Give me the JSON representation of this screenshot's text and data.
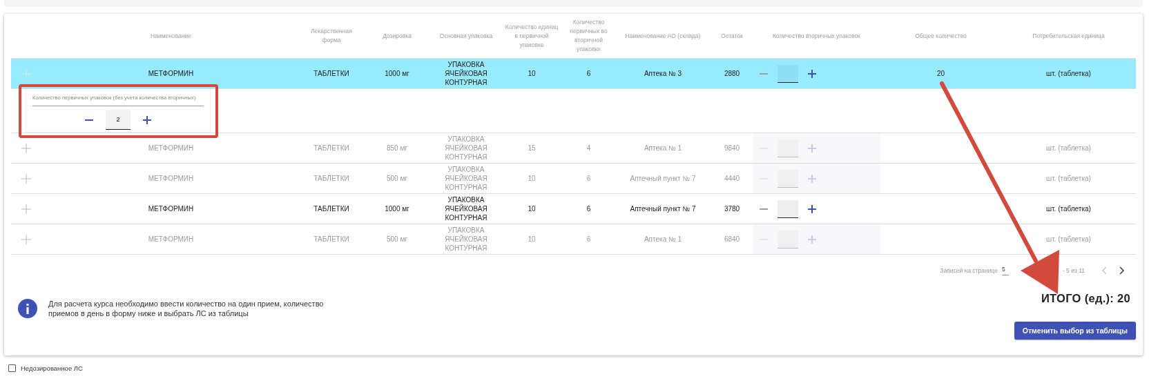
{
  "table": {
    "columns": [
      "Наименование",
      "Лекарственная форма",
      "Дозировка",
      "Основная упаковка",
      "Количество единиц в первичной упаковке",
      "Количество первичных во вторичной упаковке",
      "Наименование АО (склада)",
      "Остаток",
      "Количество вторичных упаковок",
      "Общее количество",
      "Потребительская единица"
    ],
    "rows": [
      {
        "name": "МЕТФОРМИН",
        "form": "ТАБЛЕТКИ",
        "dose": "1000 мг",
        "packaging": "УПАКОВКА ЯЧЕЙКОВАЯ КОНТУРНАЯ",
        "units": "10",
        "primary": "6",
        "pharmacy": "Аптека № 3",
        "stock": "2880",
        "total": "20",
        "unit": "шт. (таблетка)",
        "selected": true,
        "disabled": false,
        "expanded": true,
        "panel": {
          "label": "Количество первичных упаковок (без учета количества вторичных)",
          "value": "2"
        }
      },
      {
        "name": "МЕТФОРМИН",
        "form": "ТАБЛЕТКИ",
        "dose": "850 мг",
        "packaging": "УПАКОВКА ЯЧЕЙКОВАЯ КОНТУРНАЯ",
        "units": "15",
        "primary": "4",
        "pharmacy": "Аптека № 1",
        "stock": "9840",
        "unit": "шт. (таблетка)",
        "selected": false,
        "disabled": true,
        "expanded": false
      },
      {
        "name": "МЕТФОРМИН",
        "form": "ТАБЛЕТКИ",
        "dose": "500 мг",
        "packaging": "УПАКОВКА ЯЧЕЙКОВАЯ КОНТУРНАЯ",
        "units": "10",
        "primary": "6",
        "pharmacy": "Аптечный пункт № 7",
        "stock": "4440",
        "unit": "шт. (таблетка)",
        "selected": false,
        "disabled": true,
        "expanded": false
      },
      {
        "name": "МЕТФОРМИН",
        "form": "ТАБЛЕТКИ",
        "dose": "1000 мг",
        "packaging": "УПАКОВКА ЯЧЕЙКОВАЯ КОНТУРНАЯ",
        "units": "10",
        "primary": "6",
        "pharmacy": "Аптечный пункт № 7",
        "stock": "3780",
        "unit": "шт. (таблетка)",
        "selected": false,
        "disabled": false,
        "expanded": false
      },
      {
        "name": "МЕТФОРМИН",
        "form": "ТАБЛЕТКИ",
        "dose": "500 мг",
        "packaging": "УПАКОВКА ЯЧЕЙКОВАЯ КОНТУРНАЯ",
        "units": "10",
        "primary": "6",
        "pharmacy": "Аптека № 1",
        "stock": "6840",
        "unit": "шт. (таблетка)",
        "selected": false,
        "disabled": true,
        "expanded": false
      }
    ]
  },
  "pagination": {
    "label": "Записей на странице",
    "per_page": "5",
    "range": "- 5 из 11",
    "prev_disabled": true
  },
  "info": "Для расчета курса необходимо ввести количество на один прием, количество приемов в день в форму ниже и выбрать ЛС из таблицы",
  "total": "ИТОГО (ед.): 20",
  "cancel_button": "Отменить выбор из таблицы",
  "checkbox": {
    "label": "Недозированное ЛС",
    "checked": false
  },
  "annotations": {
    "highlight_frame": true,
    "arrow": true
  }
}
